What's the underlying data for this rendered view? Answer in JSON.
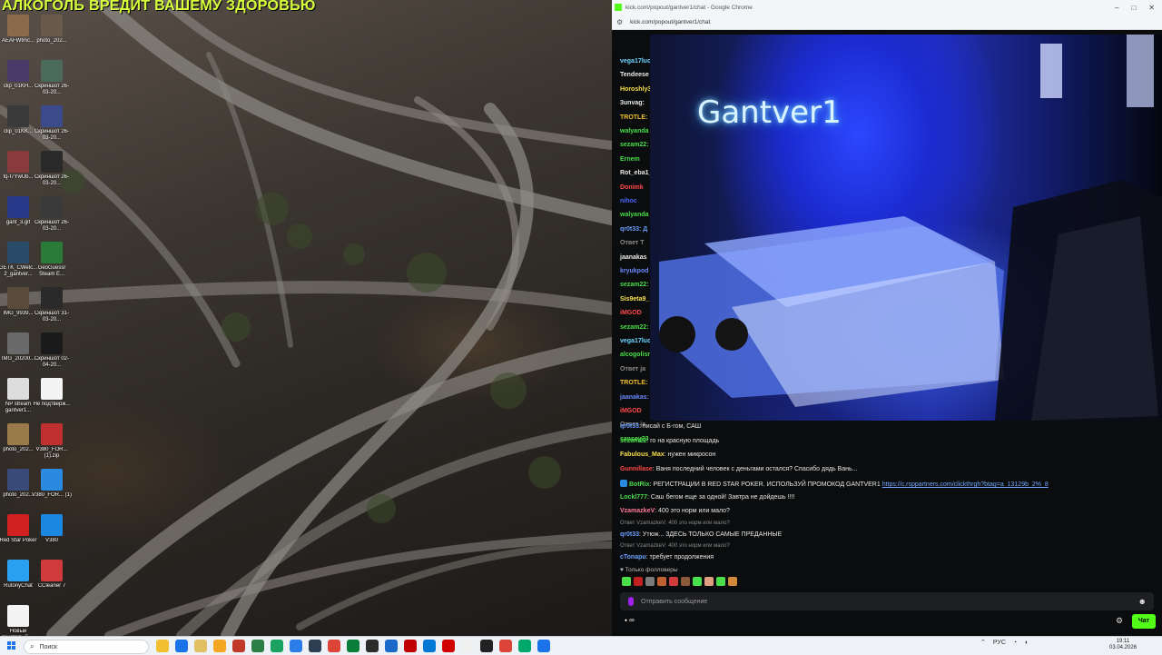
{
  "desktop": {
    "banner": "АЛКОГОЛЬ ВРЕДИТ ВАШЕМУ ЗДОРОВЬЮ",
    "icons": [
      {
        "label": "AEAFWtmc...",
        "icon": "image-file-icon",
        "color": "#8a6a4a"
      },
      {
        "label": "photo_202...",
        "icon": "image-file-icon",
        "color": "#6a5a4a"
      },
      {
        "label": "clip_01KH...",
        "icon": "video-file-icon",
        "color": "#4a3a6a"
      },
      {
        "label": "Скриншот 26-03-20...",
        "icon": "screenshot-file-icon",
        "color": "#4a6a5a"
      },
      {
        "label": "clip_01KK...",
        "icon": "video-file-icon",
        "color": "#3a3a3a"
      },
      {
        "label": "Скриншот 26-03-20...",
        "icon": "screenshot-file-icon",
        "color": "#3a4a8a"
      },
      {
        "label": "fq-f7YwUb...",
        "icon": "image-file-icon",
        "color": "#8a3a3a"
      },
      {
        "label": "Скриншот 26-03-20...",
        "icon": "screenshot-file-icon",
        "color": "#2a2a2a"
      },
      {
        "label": "gant_3.gif",
        "icon": "gif-file-icon",
        "color": "#2a3a8a"
      },
      {
        "label": "Скриншот 26-03-20...",
        "icon": "screenshot-file-icon",
        "color": "#3a3a3a"
      },
      {
        "label": "GETK_CWelc... 2_gantver...",
        "icon": "image-file-icon",
        "color": "#2a4a6a"
      },
      {
        "label": "GeoGuessr Steam E...",
        "icon": "geoguessr-app-icon",
        "color": "#2a7a3a"
      },
      {
        "label": "IMG_9939...",
        "icon": "image-file-icon",
        "color": "#5a4a3a"
      },
      {
        "label": "Скриншот 31-03-20...",
        "icon": "screenshot-file-icon",
        "color": "#2a2a2a"
      },
      {
        "label": "IMG_20200...",
        "icon": "image-file-icon",
        "color": "#6a6a6a"
      },
      {
        "label": "Скриншот 02-04-20...",
        "icon": "screenshot-file-icon",
        "color": "#1a1a1a"
      },
      {
        "label": "NP stream gantver1...",
        "icon": "text-file-icon",
        "color": "#dddddd"
      },
      {
        "label": "Не подтверж...",
        "icon": "document-file-icon",
        "color": "#f4f4f4"
      },
      {
        "label": "photo_202...",
        "icon": "image-file-icon",
        "color": "#9a7a4a"
      },
      {
        "label": "V380_FOR... (1).zip",
        "icon": "zip-file-icon",
        "color": "#c03030"
      },
      {
        "label": "photo_202...",
        "icon": "image-file-icon",
        "color": "#3a4a7a"
      },
      {
        "label": "V380_FOR... (1)",
        "icon": "app-file-icon",
        "color": "#2a8ae0"
      },
      {
        "label": "Red Star Poker",
        "icon": "red-star-poker-icon",
        "color": "#d02020"
      },
      {
        "label": "V380",
        "icon": "v380-app-icon",
        "color": "#1a88e0"
      },
      {
        "label": "RutonyChat",
        "icon": "rutonychat-icon",
        "color": "#2aa0f0"
      },
      {
        "label": "CCleaner 7",
        "icon": "ccleaner-icon",
        "color": "#d03a3a"
      },
      {
        "label": "Новый текстовый ...",
        "icon": "text-file-icon",
        "color": "#f4f4f4"
      }
    ]
  },
  "browser": {
    "title": "kick.com/popout/gantver1/chat - Google Chrome",
    "url": "kick.com/popout/gantver1/chat",
    "window_controls": [
      "–",
      "□",
      "✕"
    ]
  },
  "stream": {
    "neon_sign": "Gantver1"
  },
  "chat_top": [
    {
      "user": "vega17luc",
      "color": "#6ad4ff",
      "text": ""
    },
    {
      "user": "Tendeese",
      "color": "#e8e8e8",
      "text": ""
    },
    {
      "user": "Horoshly3",
      "color": "#f5e04a",
      "text": ""
    },
    {
      "user": "3unvag:",
      "color": "#e8e8e8",
      "text": ""
    },
    {
      "user": "TROTLE:",
      "color": "#f2c12e",
      "text": ""
    },
    {
      "user": "walyanda",
      "color": "#4adf4a",
      "text": ""
    },
    {
      "user": "sezam22:",
      "color": "#4adf4a",
      "text": ""
    },
    {
      "user": "Ernem",
      "color": "#4adf4a",
      "text": ""
    },
    {
      "user": "Rot_eba1_",
      "color": "#e8e8e8",
      "text": ""
    },
    {
      "user": "Donimk",
      "color": "#ff4a4a",
      "text": ""
    },
    {
      "user": "nihoc",
      "color": "#4a6aff",
      "text": ""
    },
    {
      "user": "walyanda",
      "color": "#4adf4a",
      "text": ""
    },
    {
      "user": "qr0t33: Д",
      "color": "#6aa0ff",
      "text": ""
    },
    {
      "user": "Ответ T",
      "color": "#8a8a8a",
      "text": ""
    },
    {
      "user": "jaanakas",
      "color": "#e8e8e8",
      "text": ""
    },
    {
      "user": "kryukpod",
      "color": "#6a8aff",
      "text": ""
    },
    {
      "user": "sezam22:",
      "color": "#4adf4a",
      "text": ""
    },
    {
      "user": "Sis9eta9_",
      "color": "#f5e04a",
      "text": ""
    },
    {
      "user": "iMGOD",
      "color": "#ff4a4a",
      "text": ""
    },
    {
      "user": "sezam22:",
      "color": "#4adf4a",
      "text": ""
    },
    {
      "user": "vega17luc",
      "color": "#6ad4ff",
      "text": ""
    },
    {
      "user": "alcogolism",
      "color": "#4adf4a",
      "text": ""
    },
    {
      "user": "Ответ ja",
      "color": "#8a8a8a",
      "text": ""
    },
    {
      "user": "TROTLE:",
      "color": "#f2c12e",
      "text": ""
    },
    {
      "user": "jaanakas:",
      "color": "#6a8aff",
      "text": ""
    },
    {
      "user": "iMGOD",
      "color": "#ff4a4a",
      "text": ""
    },
    {
      "user": "Ответ ja",
      "color": "#8a8a8a",
      "text": ""
    },
    {
      "user": "sansey23",
      "color": "#4adf4a",
      "text": ""
    }
  ],
  "chat_bottom": [
    {
      "kind": "msg",
      "user": "qr0t33",
      "color": "#6aa0ff",
      "text": "писай с Б-гом, САШ"
    },
    {
      "kind": "msg",
      "user": "sezam22",
      "color": "#4adf4a",
      "text": "го на красную площадь"
    },
    {
      "kind": "msg",
      "user": "Fabulous_Max",
      "color": "#f5e04a",
      "text": "нужен микросон"
    },
    {
      "kind": "msg",
      "user": "Gunnillase",
      "color": "#ff4a4a",
      "text": "Ваня последний человек с деньгами остался? Спасибо дядь Вань..."
    },
    {
      "kind": "bot",
      "user": "BotRix",
      "color": "#4adf4a",
      "text": "РЕГИСТРАЦИИ В RED STAR POKER. ИСПОЛЬЗУЙ ПРОМОКОД GANTVER1",
      "link": "https://c.rsppartners.com/clickthrgh?btag=a_13129b_2%_8"
    },
    {
      "kind": "msg",
      "user": "Lockl777",
      "color": "#4adf4a",
      "text": "Саш бегом еще за одной! Завтра не дойдешь !!!!"
    },
    {
      "kind": "msg",
      "user": "VzamazkeV",
      "color": "#ff7a9a",
      "text": "400 это норм или мало?"
    },
    {
      "kind": "reply",
      "text": "Ответ VzamazkeV: 400 это норм или мало?"
    },
    {
      "kind": "msg",
      "user": "qr0t33",
      "color": "#6aa0ff",
      "text": "Утюж... ЗДЕСЬ ТОЛЬКО САМЫЕ ПРЕДАННЫЕ"
    },
    {
      "kind": "reply",
      "text": "Ответ VzamazkeV: 400 это норм или мало?"
    },
    {
      "kind": "msg",
      "user": "cTonapu",
      "color": "#6aa0ff",
      "text": "требует продолжения"
    }
  ],
  "chat_controls": {
    "followers_only": "Только фолловеры",
    "input_placeholder": "Отправить сообщение",
    "points": "∞",
    "send_label": "Чат"
  },
  "emotes": [
    "#4adf4a",
    "#c02020",
    "#7a7a7a",
    "#c06030",
    "#d03a3a",
    "#8a5a3a",
    "#4adf4a",
    "#e0a080",
    "#4adf4a",
    "#d08a3a"
  ],
  "taskbar": {
    "search_placeholder": "Поиск",
    "apps": [
      "#f0c030",
      "#1a73e8",
      "#e0c060",
      "#f5a623",
      "#c0392b",
      "#2d7d46",
      "#1aa260",
      "#2b7de9",
      "#2c3e50",
      "#db4437",
      "#0a7d3b",
      "#2c2c2c",
      "#1b6ac9",
      "#c00000",
      "#0078d4",
      "#d00000",
      "#f0f0f0",
      "#222222",
      "#db4437",
      "#00a86b",
      "#1a73e8"
    ],
    "lang": "РУС",
    "time": "19:11",
    "date": "03.04.2026"
  }
}
